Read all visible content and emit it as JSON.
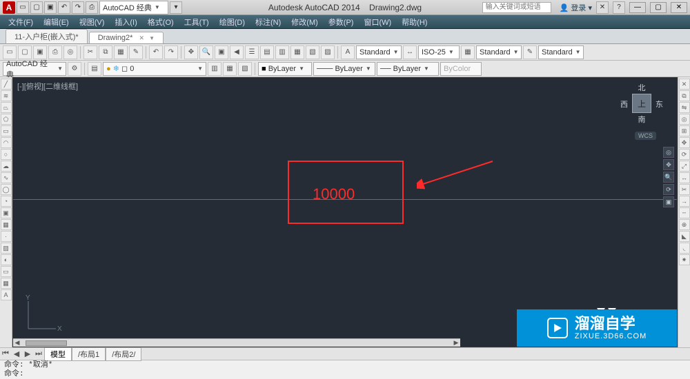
{
  "title": {
    "app": "Autodesk AutoCAD 2014",
    "doc": "Drawing2.dwg"
  },
  "qat": {
    "workspace_label": "AutoCAD 经典"
  },
  "search": {
    "placeholder": "输入关键词或短语"
  },
  "login_label": "登录",
  "menu": [
    "文件(F)",
    "编辑(E)",
    "视图(V)",
    "插入(I)",
    "格式(O)",
    "工具(T)",
    "绘图(D)",
    "标注(N)",
    "修改(M)",
    "参数(P)",
    "窗口(W)",
    "帮助(H)"
  ],
  "tabs": [
    {
      "label": "11-入户柜(嵌入式)*",
      "active": false
    },
    {
      "label": "Drawing2*",
      "active": true
    }
  ],
  "toolrow1": {
    "styles": {
      "text": "Standard",
      "dim": "ISO-25",
      "table": "Standard",
      "mleader": "Standard"
    }
  },
  "toolrow2": {
    "workspace": "AutoCAD 经典",
    "layer": "0",
    "colors": {
      "bylayer1": "ByLayer",
      "bylayer2": "ByLayer",
      "bylayer3": "ByLayer",
      "bycolor": "ByColor"
    }
  },
  "canvas": {
    "view_label": "[-][俯视][二维线框]",
    "annotation_value": "10000",
    "viewcube": {
      "n": "北",
      "s": "南",
      "e": "东",
      "w": "西",
      "top": "上",
      "wcs": "WCS"
    },
    "ucs": {
      "x": "X",
      "y": "Y"
    }
  },
  "modeltabs": {
    "model": "模型",
    "layout1": "/布局1",
    "layout2": "/布局2/"
  },
  "cmdline": {
    "line1": "命令: *取消*",
    "line2": "命令:"
  },
  "watermark": {
    "ch": "溜溜自学",
    "en": "ZIXUE.3D66.COM"
  }
}
